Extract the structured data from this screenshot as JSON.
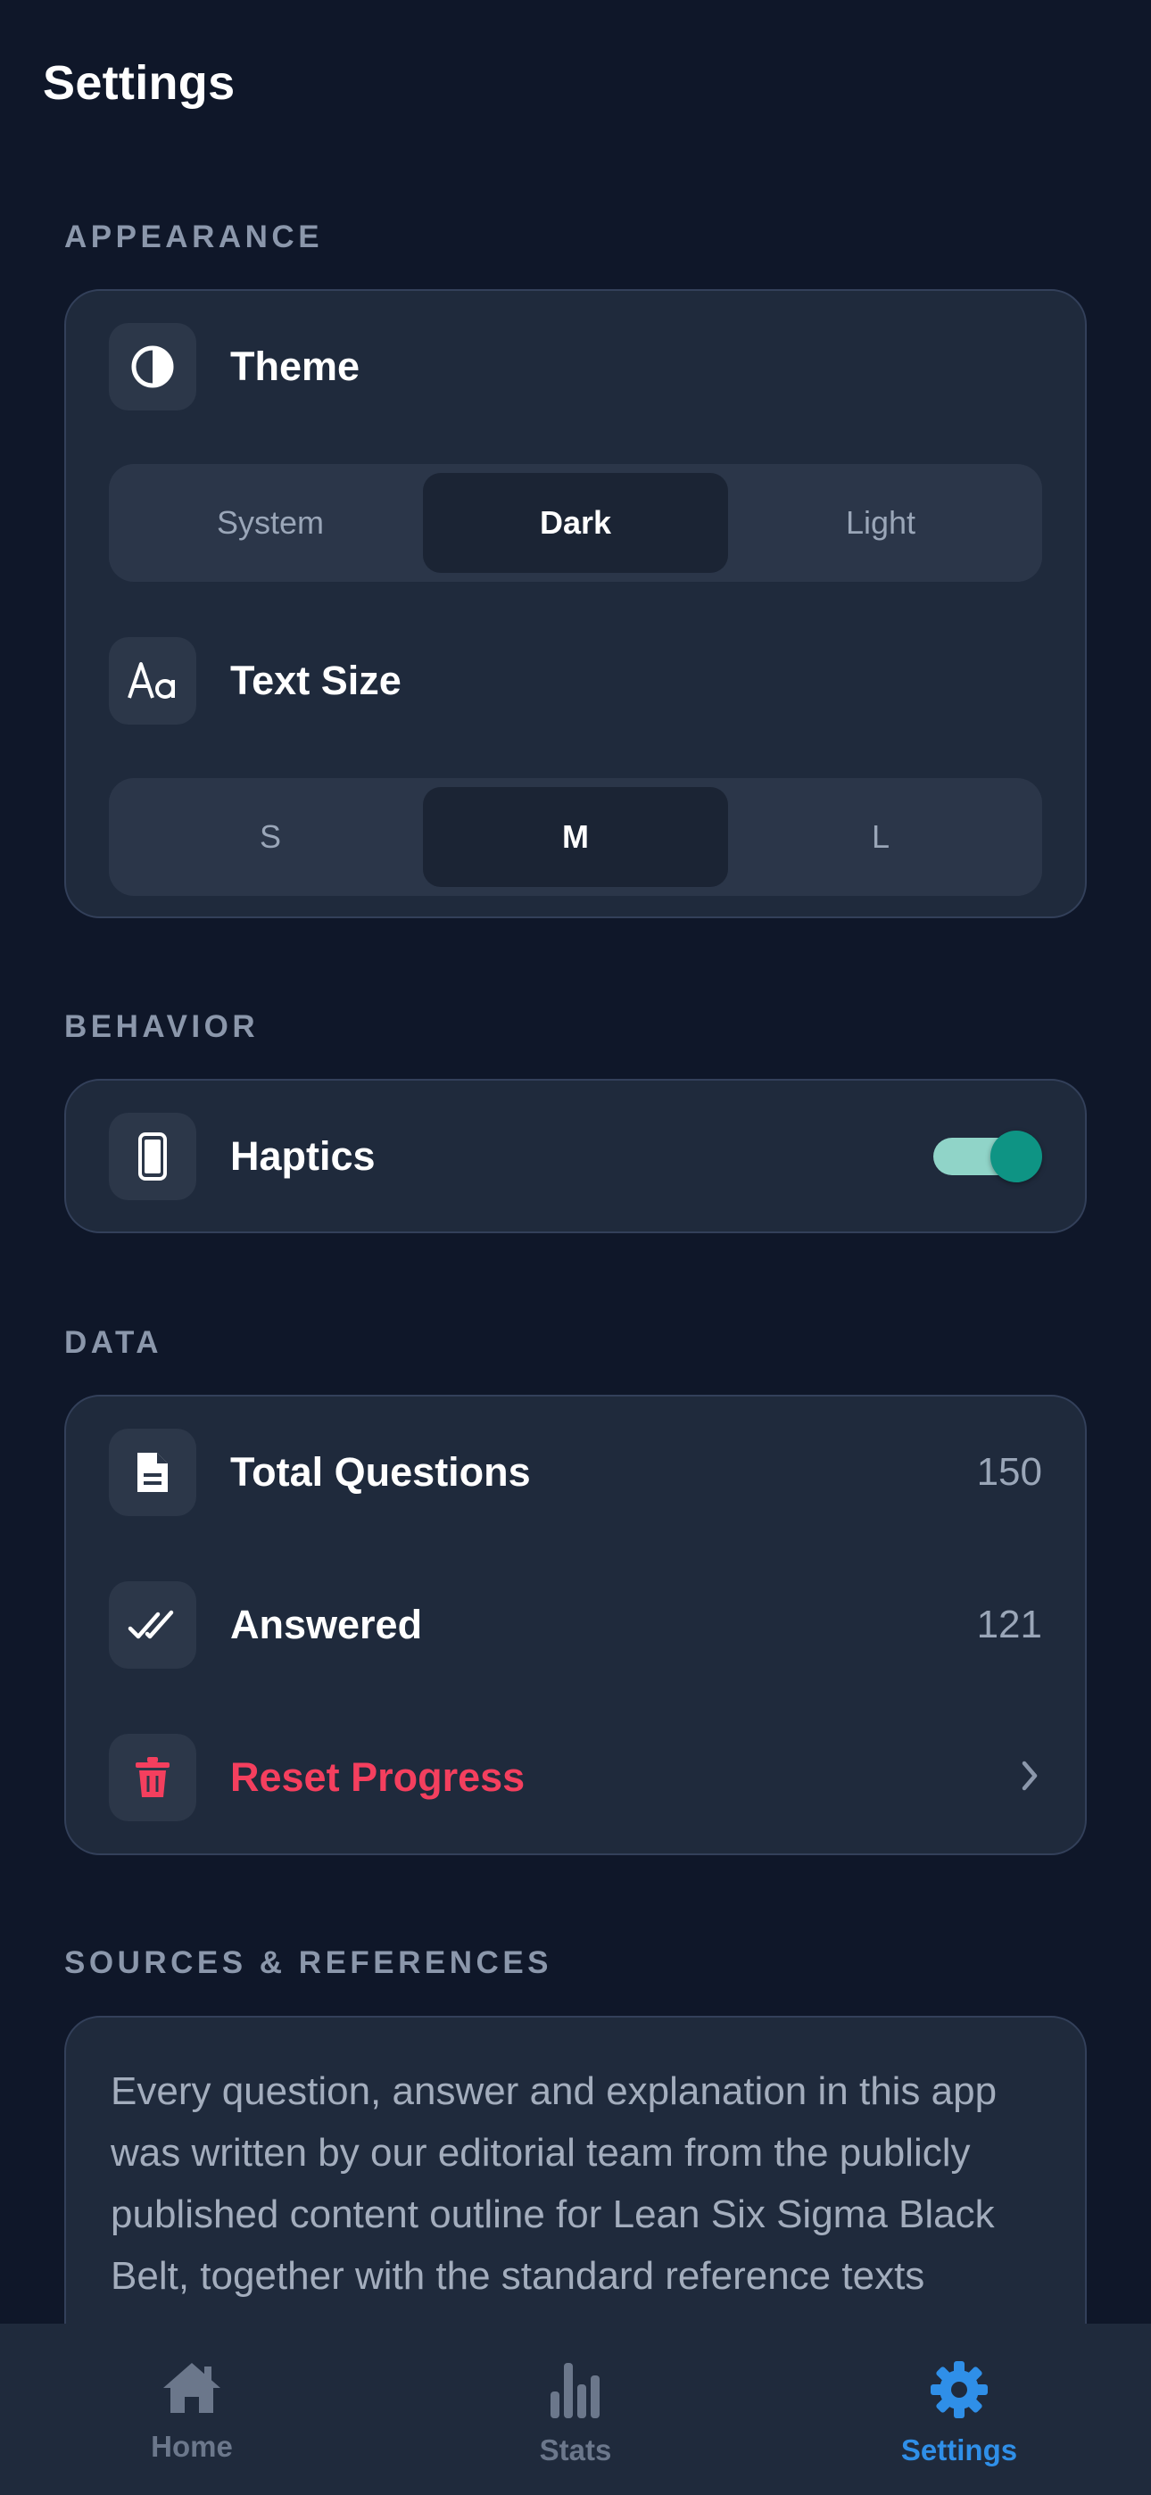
{
  "header": {
    "title": "Settings"
  },
  "sections": {
    "appearance": "APPEARANCE",
    "behavior": "BEHAVIOR",
    "data": "DATA",
    "sources": "SOURCES & REFERENCES"
  },
  "theme": {
    "label": "Theme",
    "icon": "contrast-icon",
    "options": [
      "System",
      "Dark",
      "Light"
    ],
    "selected": "Dark"
  },
  "text_size": {
    "label": "Text Size",
    "icon": "text-size-icon",
    "options": [
      "S",
      "M",
      "L"
    ],
    "selected": "M"
  },
  "haptics": {
    "label": "Haptics",
    "icon": "phone-icon",
    "enabled": true,
    "accent_color": "#0e9484"
  },
  "data_rows": {
    "total_questions": {
      "label": "Total Questions",
      "value": "150",
      "icon": "document-icon"
    },
    "answered": {
      "label": "Answered",
      "value": "121",
      "icon": "double-check-icon"
    },
    "reset": {
      "label": "Reset Progress",
      "icon": "trash-icon",
      "color": "#f43f5e"
    }
  },
  "sources": {
    "text": "Every question, answer and explanation in this app was written by our editorial team from the publicly published content outline for Lean Six Sigma Black Belt, together with the standard reference texts"
  },
  "tabbar": {
    "items": [
      {
        "label": "Home",
        "icon": "home-icon"
      },
      {
        "label": "Stats",
        "icon": "bar-chart-icon"
      },
      {
        "label": "Settings",
        "icon": "gear-icon"
      }
    ],
    "active": "Settings",
    "active_color": "#2f8fe8"
  }
}
